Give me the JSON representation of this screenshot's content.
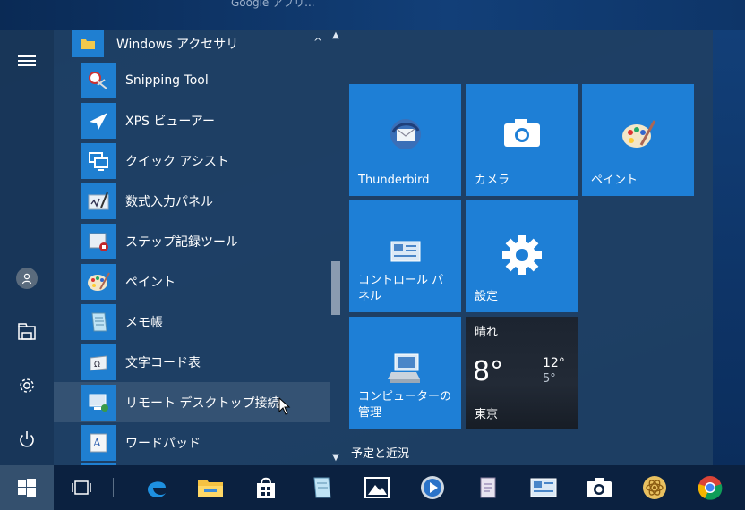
{
  "desktop": {
    "title_fragment": "Google アプリ..."
  },
  "rail": {
    "icons": [
      "hamburger-icon",
      "user-icon",
      "explorer-icon",
      "settings-icon",
      "power-icon"
    ]
  },
  "applist": {
    "header": {
      "label": "Windows アクセサリ",
      "collapse_glyph": "^"
    },
    "items": [
      {
        "label": "Snipping Tool",
        "icon": "snipping-tool-icon"
      },
      {
        "label": "XPS ビューアー",
        "icon": "xps-viewer-icon"
      },
      {
        "label": "クイック アシスト",
        "icon": "quick-assist-icon"
      },
      {
        "label": "数式入力パネル",
        "icon": "math-input-icon"
      },
      {
        "label": "ステップ記録ツール",
        "icon": "steps-recorder-icon"
      },
      {
        "label": "ペイント",
        "icon": "paint-icon"
      },
      {
        "label": "メモ帳",
        "icon": "notepad-icon"
      },
      {
        "label": "文字コード表",
        "icon": "charmap-icon"
      },
      {
        "label": "リモート デスクトップ接続",
        "icon": "remote-desktop-icon"
      },
      {
        "label": "ワードパッド",
        "icon": "wordpad-icon"
      }
    ]
  },
  "tiles": [
    {
      "label": "Thunderbird",
      "icon": "thunderbird-icon"
    },
    {
      "label": "カメラ",
      "icon": "camera-icon"
    },
    {
      "label": "ペイント",
      "icon": "paint-icon"
    },
    {
      "label": "コントロール パネル",
      "icon": "control-panel-icon"
    },
    {
      "label": "設定",
      "icon": "gear-icon"
    },
    {
      "label": "コンピューターの管理",
      "icon": "computer-management-icon"
    }
  ],
  "weather": {
    "condition": "晴れ",
    "temperature": "8°",
    "high": "12°",
    "low": "5°",
    "city": "東京"
  },
  "group_label": "予定と近況",
  "taskbar": {
    "icons": [
      "windows-start-icon",
      "task-view-icon",
      "edge-icon",
      "file-explorer-icon",
      "store-icon",
      "notepad-icon",
      "photos-icon",
      "media-player-icon",
      "document-icon",
      "control-panel-icon",
      "camera-icon",
      "atom-icon",
      "chrome-icon"
    ]
  },
  "colors": {
    "accent": "#1e7fd6",
    "menu_bg": "#204064",
    "taskbar": "#0b2140"
  }
}
